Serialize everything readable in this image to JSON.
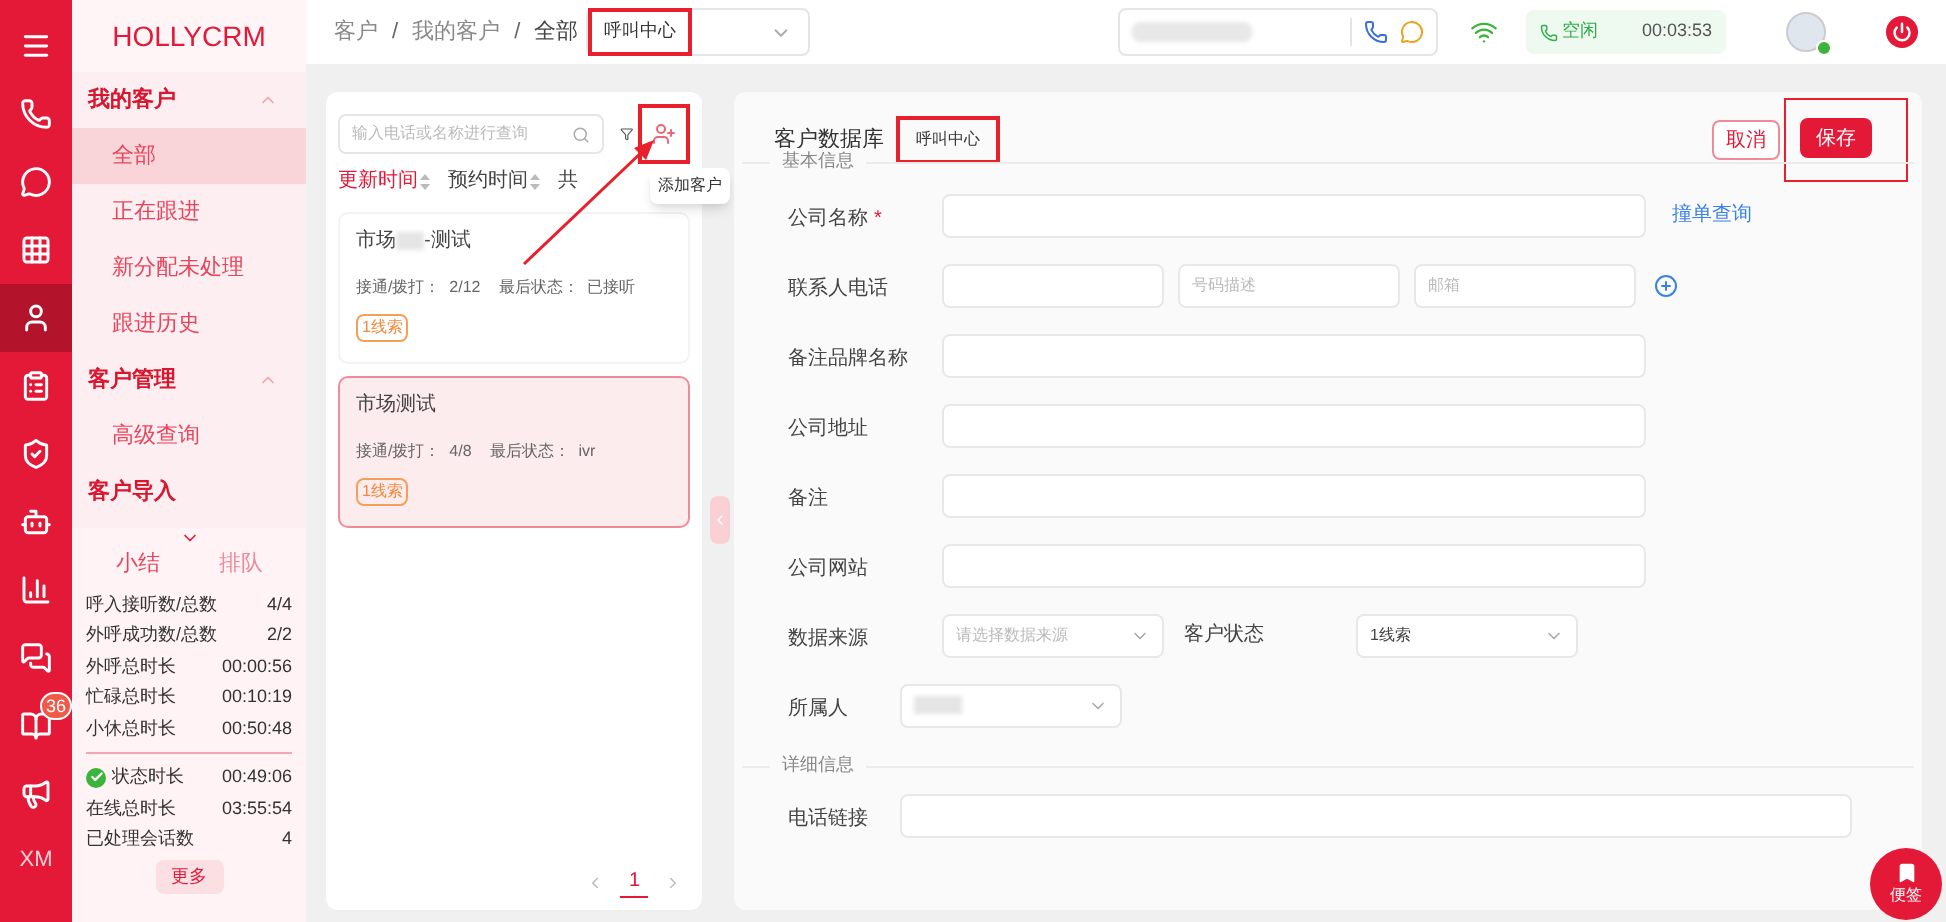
{
  "app": {
    "logo": "HOLLYCRM",
    "rail_footer": "XM",
    "rail": [
      {
        "selected": false
      },
      {
        "selected": false
      },
      {
        "selected": false
      },
      {
        "selected": false
      },
      {
        "selected": true
      },
      {
        "selected": false
      },
      {
        "selected": false
      },
      {
        "selected": false
      },
      {
        "selected": false
      },
      {
        "selected": false
      },
      {
        "selected": false,
        "badge": "36"
      },
      {
        "selected": false
      }
    ]
  },
  "sidebar": {
    "groups": [
      {
        "title": "我的客户",
        "expanded": true,
        "items": [
          {
            "label": "全部",
            "selected": true
          },
          {
            "label": "正在跟进",
            "selected": false
          },
          {
            "label": "新分配未处理",
            "selected": false
          },
          {
            "label": "跟进历史",
            "selected": false
          }
        ]
      },
      {
        "title": "客户管理",
        "expanded": true,
        "items": [
          {
            "label": "高级查询",
            "selected": false
          }
        ]
      },
      {
        "title": "客户导入"
      }
    ]
  },
  "summary": {
    "tabs": [
      {
        "label": "小结",
        "selected": true
      },
      {
        "label": "排队",
        "selected": false
      }
    ],
    "stats": [
      {
        "label": "呼入接听数/总数",
        "value": "4/4"
      },
      {
        "label": "外呼成功数/总数",
        "value": "2/2"
      },
      {
        "label": "外呼总时长",
        "value": "00:00:56"
      },
      {
        "label": "忙碌总时长",
        "value": "00:10:19"
      },
      {
        "label": "小休总时长",
        "value": "00:50:48"
      }
    ],
    "status_stats": [
      {
        "label": "状态时长",
        "value": "00:49:06",
        "ok": true
      },
      {
        "label": "在线总时长",
        "value": "03:55:54",
        "ok": false
      },
      {
        "label": "已处理会话数",
        "value": "4",
        "ok": false
      }
    ],
    "more": "更多"
  },
  "topbar": {
    "breadcrumb": [
      {
        "label": "客户"
      },
      {
        "separator": "/",
        "label": "我的客户"
      },
      {
        "separator": "/",
        "label": "全部"
      }
    ],
    "org_select": "呼叫中心",
    "status": "空闲",
    "timer": "00:03:53"
  },
  "list": {
    "search_placeholder": "输入电话或名称进行查询",
    "tooltip": "添加客户",
    "sorts": [
      {
        "label": "更新时间",
        "selected": true
      },
      {
        "label": "预约时间",
        "selected": false
      }
    ],
    "count_label": "共",
    "cards": [
      {
        "title_parts": [
          "市场",
          "-测试"
        ],
        "stats": "接通/拨打：  2/12",
        "last": "最后状态：  已接听",
        "tag": "1线索",
        "selected": false
      },
      {
        "title_parts": [
          "市场测试"
        ],
        "stats": "接通/拨打：  4/8",
        "last": "最后状态：  ivr",
        "tag": "1线索",
        "selected": true
      }
    ],
    "page": "1"
  },
  "form": {
    "title": "客户数据库",
    "org": "呼叫中心",
    "cancel": "取消",
    "save": "保存",
    "sections": [
      {
        "title": "基本信息",
        "rows": [
          {
            "kind": "text",
            "label": "公司名称",
            "required_mark": "*",
            "link": "撞单查询"
          },
          {
            "kind": "phone",
            "label": "联系人电话",
            "placeholders": [
              "号码描述",
              "邮箱"
            ]
          },
          {
            "kind": "text",
            "label": "备注品牌名称"
          },
          {
            "kind": "text",
            "label": "公司地址"
          },
          {
            "kind": "text",
            "label": "备注"
          },
          {
            "kind": "text",
            "label": "公司网站"
          },
          {
            "kind": "selects",
            "label": "数据来源",
            "placeholder": "请选择数据来源",
            "label2": "客户状态",
            "value2": "1线索"
          },
          {
            "kind": "owner",
            "label": "所属人"
          }
        ]
      },
      {
        "title": "详细信息",
        "rows": [
          {
            "kind": "wide",
            "label": "电话链接"
          }
        ]
      }
    ]
  },
  "note_button": "便签"
}
